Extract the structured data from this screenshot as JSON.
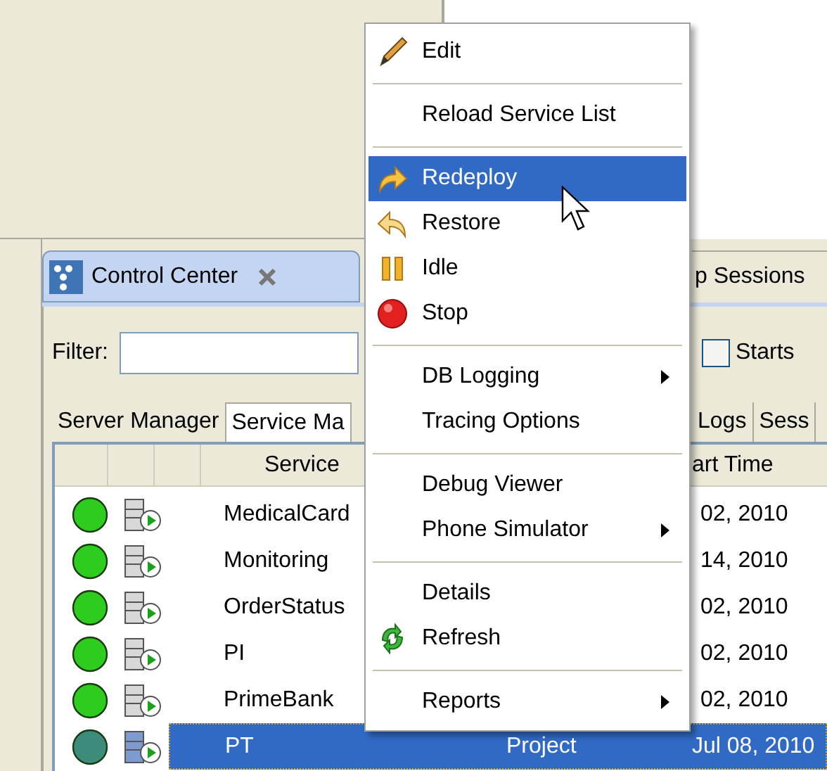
{
  "view_tabs": [
    {
      "label": "Control Center",
      "selected": true,
      "closable": true
    },
    {
      "label": "p Sessions",
      "selected": false,
      "closable": false
    }
  ],
  "filter": {
    "label": "Filter:"
  },
  "starts_checkbox": {
    "label": "Starts",
    "checked": false
  },
  "sub_tabs": [
    {
      "label": "Server Manager",
      "selected": false
    },
    {
      "label": "Service Ma",
      "selected": true
    },
    {
      "label": "Logs",
      "selected": false
    },
    {
      "label": "Sess",
      "selected": false
    }
  ],
  "table": {
    "columns": [
      "Service",
      "art Time"
    ],
    "rows": [
      {
        "service": "MedicalCard",
        "start_time": "02, 2010",
        "selected": false
      },
      {
        "service": "Monitoring",
        "start_time": "14, 2010",
        "selected": false
      },
      {
        "service": "OrderStatus",
        "start_time": "02, 2010",
        "selected": false
      },
      {
        "service": "PI",
        "start_time": "02, 2010",
        "selected": false
      },
      {
        "service": "PrimeBank",
        "start_time": "02, 2010",
        "selected": false
      },
      {
        "service": "PT",
        "type": "Project",
        "start_time": "Jul 08, 2010",
        "selected": true
      }
    ]
  },
  "context_menu": {
    "items": [
      {
        "kind": "edit",
        "label": "Edit",
        "selected": false,
        "submenu": false
      },
      {
        "kind": "separator"
      },
      {
        "kind": "plain",
        "label": "Reload Service List",
        "selected": false,
        "submenu": false
      },
      {
        "kind": "separator"
      },
      {
        "kind": "redeploy",
        "label": "Redeploy",
        "selected": true,
        "submenu": false
      },
      {
        "kind": "restore",
        "label": "Restore",
        "selected": false,
        "submenu": false
      },
      {
        "kind": "idle",
        "label": "Idle",
        "selected": false,
        "submenu": false
      },
      {
        "kind": "stop",
        "label": "Stop",
        "selected": false,
        "submenu": false
      },
      {
        "kind": "separator"
      },
      {
        "kind": "plain",
        "label": "DB Logging",
        "selected": false,
        "submenu": true
      },
      {
        "kind": "plain",
        "label": "Tracing Options",
        "selected": false,
        "submenu": false
      },
      {
        "kind": "separator"
      },
      {
        "kind": "plain",
        "label": "Debug Viewer",
        "selected": false,
        "submenu": false
      },
      {
        "kind": "plain",
        "label": "Phone Simulator",
        "selected": false,
        "submenu": true
      },
      {
        "kind": "separator"
      },
      {
        "kind": "plain",
        "label": "Details",
        "selected": false,
        "submenu": false
      },
      {
        "kind": "refresh",
        "label": "Refresh",
        "selected": false,
        "submenu": false
      },
      {
        "kind": "separator"
      },
      {
        "kind": "plain",
        "label": "Reports",
        "selected": false,
        "submenu": true
      }
    ]
  }
}
